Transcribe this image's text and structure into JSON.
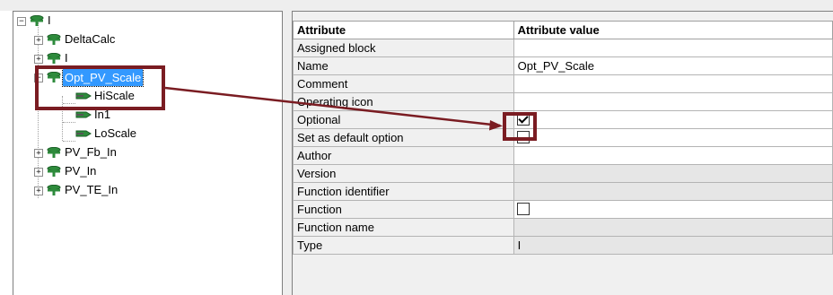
{
  "tree": {
    "items": [
      {
        "label": "I",
        "expander": "-"
      },
      {
        "label": "DeltaCalc",
        "expander": "+"
      },
      {
        "label": "I",
        "expander": "+"
      },
      {
        "label": "Opt_PV_Scale",
        "expander": "-"
      },
      {
        "label": "HiScale"
      },
      {
        "label": "In1"
      },
      {
        "label": "LoScale"
      },
      {
        "label": "PV_Fb_In",
        "expander": "+"
      },
      {
        "label": "PV_In",
        "expander": "+"
      },
      {
        "label": "PV_TE_In",
        "expander": "+"
      }
    ]
  },
  "table": {
    "headers": {
      "attribute": "Attribute",
      "value": "Attribute value"
    },
    "rows": [
      {
        "attribute": "Assigned block",
        "value": ""
      },
      {
        "attribute": "Name",
        "value": "Opt_PV_Scale"
      },
      {
        "attribute": "Comment",
        "value": ""
      },
      {
        "attribute": "Operating icon",
        "value": ""
      },
      {
        "attribute": "Optional",
        "value": "",
        "checkbox": true,
        "checked": true
      },
      {
        "attribute": "Set as default option",
        "value": "",
        "checkbox": true,
        "checked": false
      },
      {
        "attribute": "Author",
        "value": ""
      },
      {
        "attribute": "Version",
        "value": ""
      },
      {
        "attribute": "Function identifier",
        "value": ""
      },
      {
        "attribute": "Function",
        "value": "",
        "checkbox": true,
        "checked": false
      },
      {
        "attribute": "Function name",
        "value": ""
      },
      {
        "attribute": "Type",
        "value": "I"
      }
    ]
  },
  "colors": {
    "callout": "#7a1c22",
    "selection": "#3399ff",
    "block_icon": "#2e8b3c"
  },
  "icons": {
    "block": "function-block-icon",
    "input": "input-connector-icon"
  }
}
